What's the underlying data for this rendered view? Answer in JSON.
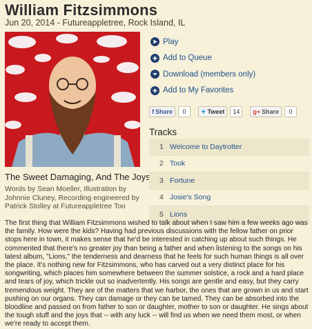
{
  "header": {
    "title": "William Fitzsimmons",
    "subtitle": "Jun 20, 2014 - Futureappletree, Rock Island, IL"
  },
  "album": {
    "title": "The Sweet Damaging, And The Joys",
    "credits": "Words by Sean Moeller, Illustration by Johnnie Cluney, Recording engineered by Patrick Stolley at Futureappletree Too"
  },
  "actions": [
    {
      "label": "Play",
      "icon": "play-icon"
    },
    {
      "label": "Add to Queue",
      "icon": "plus-icon"
    },
    {
      "label": "Download (members only)",
      "icon": "download-icon"
    },
    {
      "label": "Add to My Favorites",
      "icon": "plus-icon"
    }
  ],
  "share": {
    "facebook": {
      "label": "Share",
      "count": "0"
    },
    "twitter": {
      "label": "Tweet",
      "count": "14"
    },
    "gplus": {
      "label": "Share",
      "count": "0"
    }
  },
  "tracks_heading": "Tracks",
  "tracks": [
    {
      "num": "1",
      "title": "Welcome to Daytrotter"
    },
    {
      "num": "2",
      "title": "Took"
    },
    {
      "num": "3",
      "title": "Fortune"
    },
    {
      "num": "4",
      "title": "Josie's Song"
    },
    {
      "num": "5",
      "title": "Lions"
    }
  ],
  "body": "The first thing that William Fitzsimmons wished to talk about when I saw him a few weeks ago was the family. How were the kids? Having had previous discussions with the fellow father on prior stops here in town, it makes sense that he'd be interested in catching up about such things. He commented that there's no greater joy than being a father and when listening to the songs on his latest album, \"Lions,\" the tenderness and dearness that he feels for such human things is all over the place. It's nothing new for Fitzsimmons, who has carved out a very distinct place for his songwriting, which places him somewhere between the summer solstice, a rock and a hard place and tears of joy, which trickle out so inadvertently. His songs are gentle and easy, but they carry tremendous weight. They are of the matters that we harbor, the ones that are grown in us and start pushing on our organs. They can damage or they can be tamed. They can be absorbed into the bloodline and passed on from father to son or daughter, mother to son or daughter. He sings about the tough stuff and the joys that -- with any luck -- will find us when we need them most, or when we're ready to accept them.",
  "colors": {
    "background": "#f7f1da",
    "link": "#1f4f8a",
    "art_red": "#c8191e",
    "icon_navy": "#1f3f6e"
  }
}
